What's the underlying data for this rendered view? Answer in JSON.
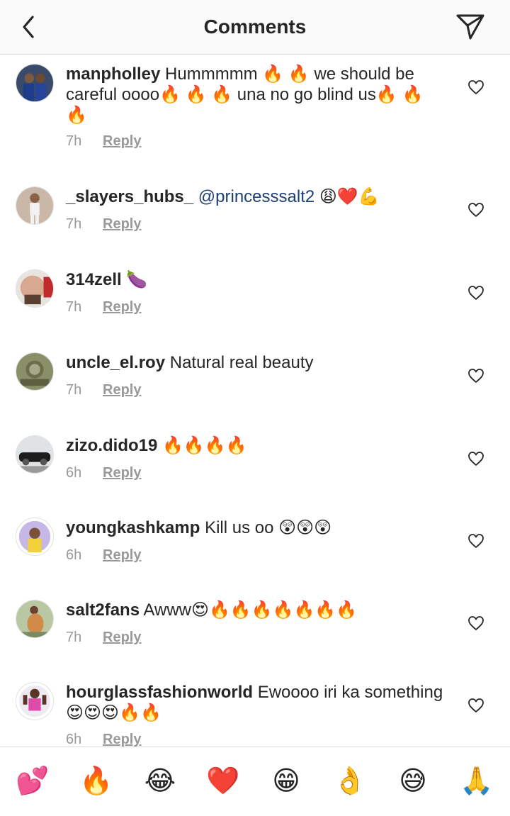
{
  "header": {
    "title": "Comments",
    "back_icon": "chevron-left-icon",
    "send_icon": "paper-plane-icon"
  },
  "reply_label": "Reply",
  "comments": [
    {
      "username": "manpholley",
      "text": "Hummmmm 🔥 🔥 we should be careful oooo🔥 🔥 🔥  una no go blind us🔥 🔥 🔥",
      "time": "7h"
    },
    {
      "username": "_slayers_hubs_",
      "mention": "@princesssalt2",
      "text": "😩❤️💪",
      "time": "7h"
    },
    {
      "username": "314zell",
      "text": "🍆",
      "time": "7h"
    },
    {
      "username": "uncle_el.roy",
      "text": "Natural real  beauty",
      "time": "7h"
    },
    {
      "username": "zizo.dido19",
      "text": "🔥🔥🔥🔥",
      "time": "6h"
    },
    {
      "username": "youngkashkamp",
      "text": "Kill us oo 😲😲😲",
      "time": "6h"
    },
    {
      "username": "salt2fans",
      "text": "Awww😍🔥🔥🔥🔥🔥🔥🔥",
      "time": "7h"
    },
    {
      "username": "hourglassfashionworld",
      "text": "Ewoooo iri ka something 😍😍😍🔥🔥",
      "time": "6h"
    }
  ],
  "emoji_bar": [
    "💕",
    "🔥",
    "😂",
    "❤️",
    "😁",
    "👌",
    "😅",
    "🙏"
  ]
}
